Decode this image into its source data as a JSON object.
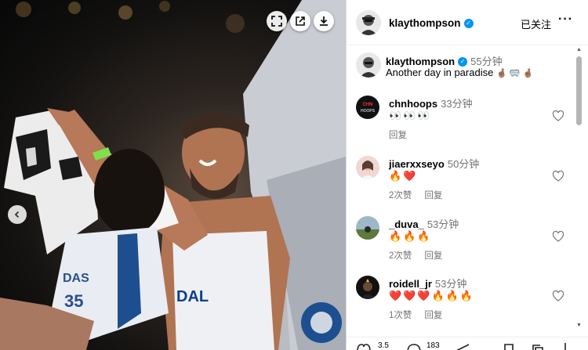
{
  "post": {
    "username": "klaythompson",
    "follow_status": "已关注",
    "caption_time": "55分钟",
    "caption_text": "Another day in paradise"
  },
  "icons": {
    "expand": "expand-icon",
    "open_new": "open-external-icon",
    "download": "download-icon",
    "prev": "chevron-left-icon",
    "more": "more-options-icon",
    "verified": "verified-badge-icon",
    "heart": "heart-icon"
  },
  "comments": [
    {
      "user": "chnhoops",
      "time": "33分钟",
      "text": "👀👀👀",
      "likes": "",
      "reply": "回复"
    },
    {
      "user": "jiaerxxseyo",
      "time": "50分钟",
      "text": "🔥❤️",
      "likes": "2次赞",
      "reply": "回复"
    },
    {
      "user": "_duva_",
      "time": "53分钟",
      "text": "🔥🔥🔥",
      "likes": "2次赞",
      "reply": "回复"
    },
    {
      "user": "roidell_jr",
      "time": "53分钟",
      "text": "❤️❤️❤️🔥🔥🔥",
      "likes": "1次赞",
      "reply": "回复"
    }
  ],
  "footer": {
    "likes_partial": "3.5",
    "comments_partial": "183"
  },
  "colors": {
    "verified": "#0095f6",
    "muted_text": "#737373",
    "border": "#dbdbdb"
  }
}
